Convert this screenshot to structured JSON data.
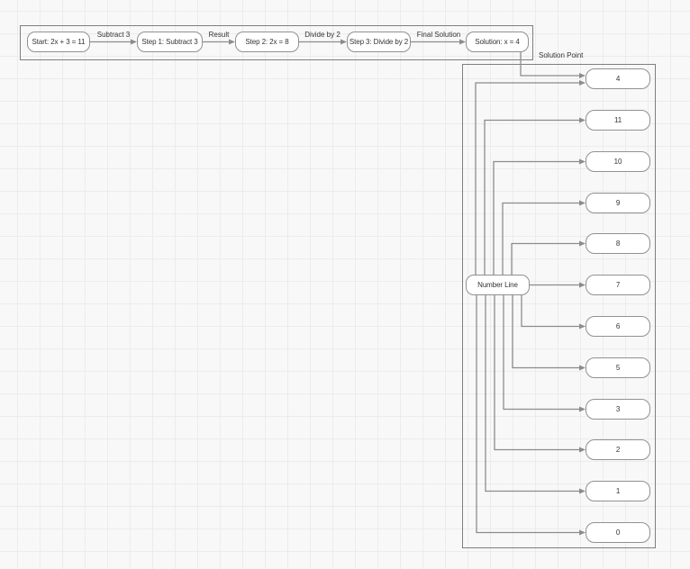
{
  "flow": {
    "nodes": [
      {
        "id": "start",
        "label": "Start: 2x + 3 = 11"
      },
      {
        "id": "step1",
        "label": "Step 1: Subtract 3"
      },
      {
        "id": "step2",
        "label": "Step 2: 2x = 8"
      },
      {
        "id": "step3",
        "label": "Step 3: Divide by 2"
      },
      {
        "id": "solution",
        "label": "Solution: x = 4"
      }
    ],
    "edges": [
      {
        "from": "start",
        "to": "step1",
        "label": "Subtract 3"
      },
      {
        "from": "step1",
        "to": "step2",
        "label": "Result"
      },
      {
        "from": "step2",
        "to": "step3",
        "label": "Divide by 2"
      },
      {
        "from": "step3",
        "to": "solution",
        "label": "Final Solution"
      },
      {
        "from": "solution",
        "to": "4",
        "label": "Solution Point"
      }
    ]
  },
  "number_line": {
    "hub": "Number Line",
    "values": [
      "4",
      "11",
      "10",
      "9",
      "8",
      "7",
      "6",
      "5",
      "3",
      "2",
      "1",
      "0"
    ]
  },
  "colors": {
    "canvas_bg": "#f8f8f8",
    "grid_line": "#ececec",
    "node_fill": "#ffffff",
    "node_border": "#919191",
    "frame_border": "#7f7f7f",
    "edge": "#8c8c8c",
    "text": "#333333"
  }
}
